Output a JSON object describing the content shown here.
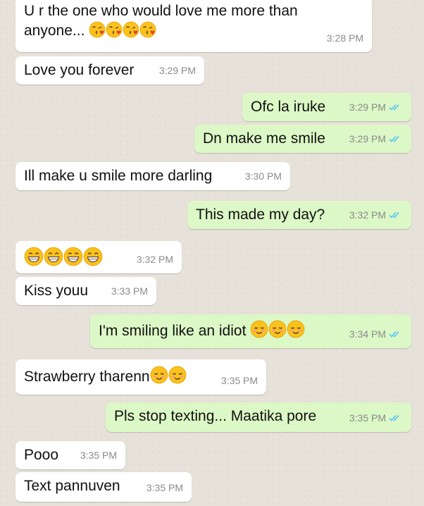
{
  "colors": {
    "incoming_bubble": "#ffffff",
    "outgoing_bubble": "#dcf8c6",
    "read_ticks": "#4fc3f7",
    "timestamp": "#8a8a8a"
  },
  "messages": [
    {
      "direction": "incoming",
      "text_line1": "U r the one who would love me more than",
      "text_line2": "anyone...",
      "emojis": [
        "kiss-emoji",
        "kiss-emoji",
        "kiss-emoji",
        "kiss-emoji"
      ],
      "time": "3:28 PM"
    },
    {
      "direction": "incoming",
      "text": "Love you forever",
      "time": "3:29 PM"
    },
    {
      "direction": "outgoing",
      "text": "Ofc la iruke",
      "time": "3:29 PM",
      "status": "read"
    },
    {
      "direction": "outgoing",
      "text": "Dn make me smile",
      "time": "3:29 PM",
      "status": "read"
    },
    {
      "direction": "incoming",
      "text": "Ill make u smile more darling",
      "time": "3:30 PM"
    },
    {
      "direction": "outgoing",
      "text": "This made my day?",
      "time": "3:32 PM",
      "status": "read"
    },
    {
      "direction": "incoming",
      "text": "",
      "emojis": [
        "grin-emoji",
        "grin-emoji",
        "grin-emoji",
        "grin-emoji"
      ],
      "time": "3:32 PM"
    },
    {
      "direction": "incoming",
      "text": "Kiss youu",
      "time": "3:33 PM"
    },
    {
      "direction": "outgoing",
      "text": "I'm smiling like an idiot",
      "emojis": [
        "blush-emoji",
        "blush-emoji",
        "blush-emoji"
      ],
      "time": "3:34 PM",
      "status": "read"
    },
    {
      "direction": "incoming",
      "text": "Strawberry tharenn",
      "emojis": [
        "blush-emoji",
        "blush-emoji"
      ],
      "time": "3:35 PM"
    },
    {
      "direction": "outgoing",
      "text": "Pls stop texting... Maatika pore",
      "time": "3:35 PM",
      "status": "read"
    },
    {
      "direction": "incoming",
      "text": "Pooo",
      "time": "3:35 PM"
    },
    {
      "direction": "incoming",
      "text": "Text pannuven",
      "time": "3:35 PM"
    }
  ]
}
